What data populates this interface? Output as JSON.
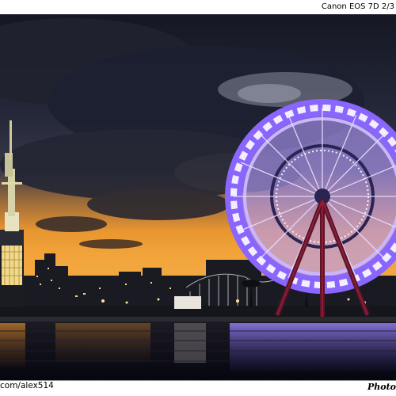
{
  "top_caption": "Canon EOS 7D 2/3",
  "bottom_left_caption": "com/alex514",
  "bottom_right_signature": "Photo",
  "colors": {
    "sky_top": "#1b1e2b",
    "sunset_orange": "#e8952a",
    "wheel_purple": "#8c6cf2",
    "wheel_white": "#f4f0ff",
    "water": "#0b0d1a"
  }
}
